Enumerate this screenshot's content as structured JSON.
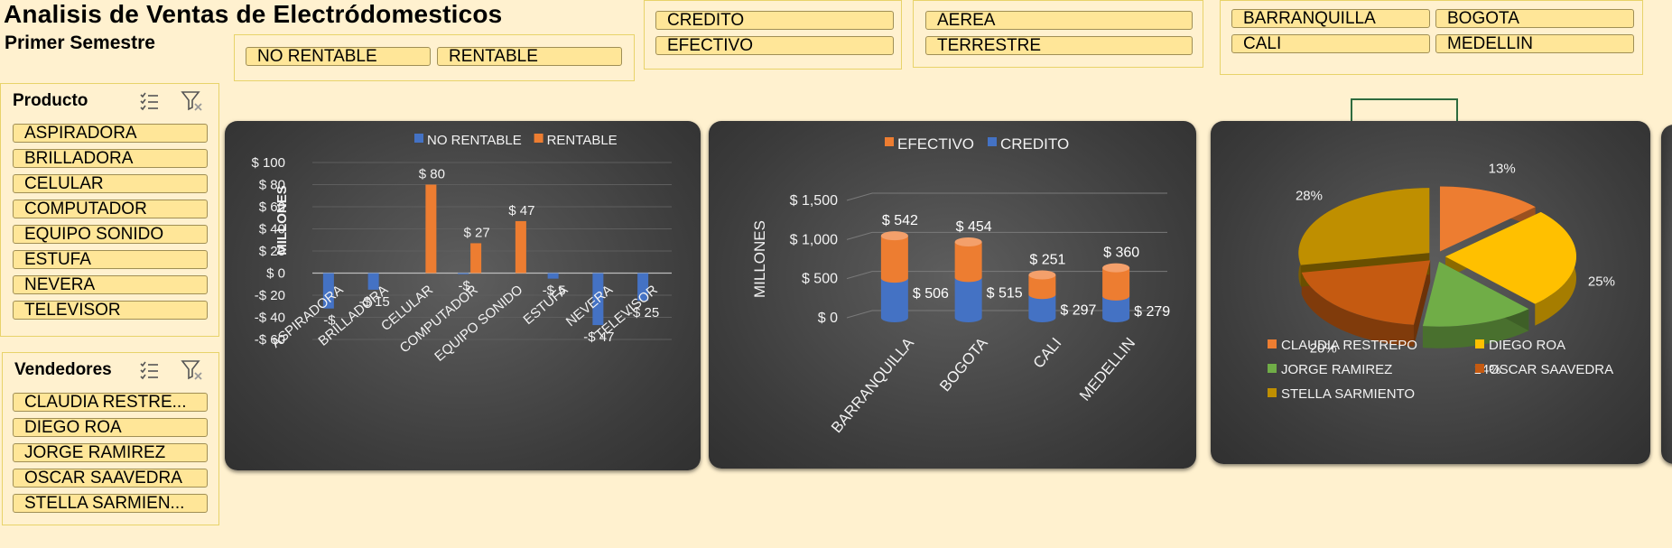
{
  "header": {
    "title": "Analisis de Ventas de Electródomesticos",
    "subtitle": "Primer Semestre"
  },
  "slicers": {
    "rentabilidad": {
      "items": [
        "NO RENTABLE",
        "RENTABLE"
      ]
    },
    "pago": {
      "items": [
        "CREDITO",
        "EFECTIVO"
      ]
    },
    "envio": {
      "items": [
        "AEREA",
        "TERRESTRE"
      ]
    },
    "ciudad": {
      "items": [
        "BARRANQUILLA",
        "BOGOTA",
        "CALI",
        "MEDELLIN"
      ]
    },
    "producto": {
      "title": "Producto",
      "items": [
        "ASPIRADORA",
        "BRILLADORA",
        "CELULAR",
        "COMPUTADOR",
        "EQUIPO SONIDO",
        "ESTUFA",
        "NEVERA",
        "TELEVISOR"
      ]
    },
    "vendedores": {
      "title": "Vendedores",
      "items": [
        "CLAUDIA RESTRE...",
        "DIEGO ROA",
        "JORGE RAMIREZ",
        "OSCAR SAAVEDRA",
        "STELLA SARMIEN..."
      ]
    },
    "icons": {
      "multiselect": "multi-select-icon",
      "clear": "clear-filter-icon"
    }
  },
  "chart_data": [
    {
      "type": "bar",
      "ylabel": "MILLONES",
      "ylim": [
        -60,
        100
      ],
      "yticks": [
        "$ 100",
        "$ 80",
        "$ 60",
        "$ 40",
        "$ 20",
        "$ 0",
        "-$ 20",
        "-$ 40",
        "-$ 60"
      ],
      "categories": [
        "ASPIRADORA",
        "BRILLADORA",
        "CELULAR",
        "COMPUTADOR",
        "EQUIPO SONIDO",
        "ESTUFA",
        "NEVERA",
        "TELEVISOR"
      ],
      "series": [
        {
          "name": "NO RENTABLE",
          "color": "#4472c4",
          "values": [
            -32,
            -15,
            0,
            -1,
            0,
            -5,
            -47,
            -25
          ],
          "labels": [
            "-$",
            "-$ 15",
            "",
            "-$",
            "",
            "-$ 5",
            "-$ 47",
            "-$ 25"
          ]
        },
        {
          "name": "RENTABLE",
          "color": "#ed7d31",
          "values": [
            0,
            0,
            80,
            27,
            47,
            0,
            0,
            0
          ],
          "labels": [
            "",
            "",
            "$ 80",
            "$ 27",
            "$ 47",
            "",
            "",
            ""
          ]
        }
      ],
      "legend": "top"
    },
    {
      "type": "bar",
      "stacked": true,
      "ylabel": "MILLONES",
      "ylim": [
        0,
        1500
      ],
      "yticks": [
        "$ 1,500",
        "$ 1,000",
        "$ 500",
        "$ 0"
      ],
      "categories": [
        "BARRANQUILLA",
        "BOGOTA",
        "CALI",
        "MEDELLIN"
      ],
      "series": [
        {
          "name": "EFECTIVO",
          "color": "#ed7d31",
          "values": [
            542,
            454,
            251,
            360
          ],
          "labels": [
            "$ 542",
            "$ 454",
            "$ 251",
            "$ 360"
          ]
        },
        {
          "name": "CREDITO",
          "color": "#4472c4",
          "values": [
            506,
            515,
            297,
            279
          ],
          "labels": [
            "$ 506",
            "$ 515",
            "$ 297",
            "$ 279"
          ]
        }
      ],
      "legend": "top"
    },
    {
      "type": "pie",
      "slices": [
        {
          "name": "CLAUDIA RESTREPO",
          "value": 13,
          "label": "13%",
          "color": "#ed7d31"
        },
        {
          "name": "DIEGO ROA",
          "value": 25,
          "label": "25%",
          "color": "#ffc000"
        },
        {
          "name": "JORGE RAMIREZ",
          "value": 14,
          "label": "14%",
          "color": "#70ad47"
        },
        {
          "name": "OSCAR SAAVEDRA",
          "value": 20,
          "label": "20%",
          "color": "#c55a11"
        },
        {
          "name": "STELLA SARMIENTO",
          "value": 28,
          "label": "28%",
          "color": "#bf8f00"
        }
      ],
      "legend": "bottom"
    }
  ]
}
